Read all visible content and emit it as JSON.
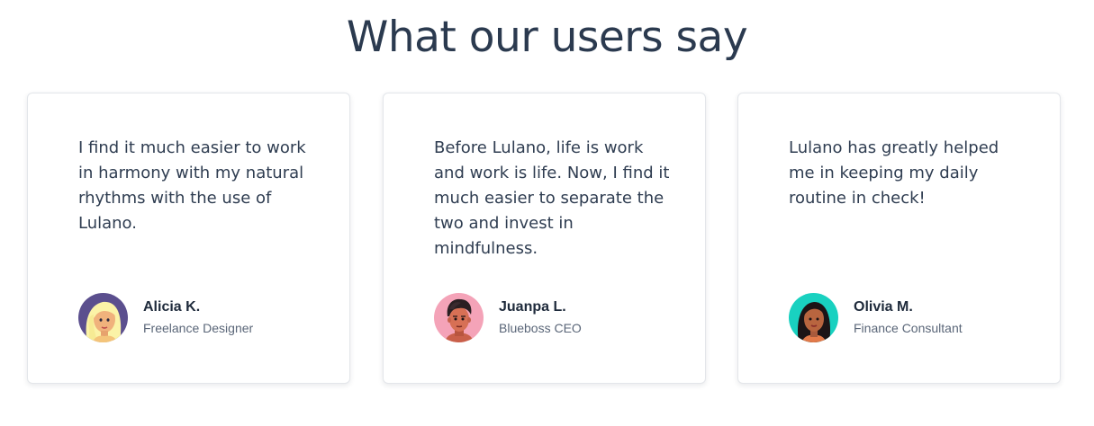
{
  "section": {
    "title": "What our users say"
  },
  "testimonials": [
    {
      "quote": "I find it much easier to work in harmony with my natural rhythms with the use of Lulano.",
      "name": "Alicia K.",
      "role": "Freelance Designer",
      "avatar_icon": "woman-blonde-avatar-icon",
      "avatar_bg": "#5b4f8e"
    },
    {
      "quote": "Before Lulano, life is work and work is life. Now, I find it much easier to separate the two and invest in mindfulness.",
      "name": "Juanpa L.",
      "role": "Blueboss CEO",
      "avatar_icon": "man-dark-hair-avatar-icon",
      "avatar_bg": "#f4a3b8"
    },
    {
      "quote": "Lulano has greatly helped me in keeping my daily routine in check!",
      "name": "Olivia M.",
      "role": "Finance Consultant",
      "avatar_icon": "woman-dark-hair-avatar-icon",
      "avatar_bg": "#19d1c0"
    }
  ]
}
